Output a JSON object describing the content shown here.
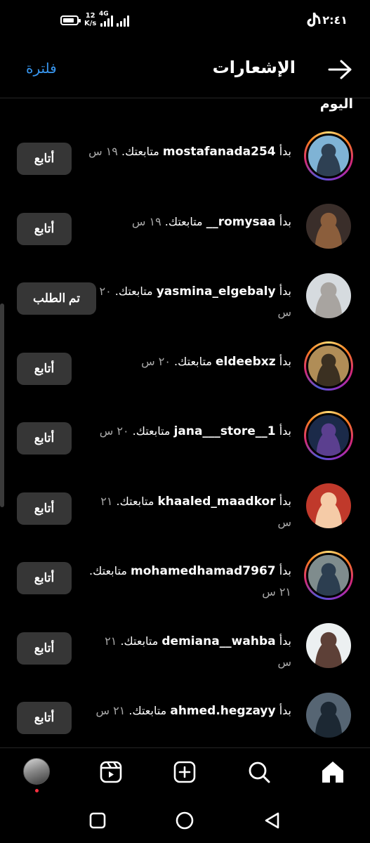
{
  "status_bar": {
    "time": "١٢:٤١",
    "net_speed_value": "12",
    "net_speed_unit": "K/s",
    "network_type": "4G",
    "battery_level": 0.85
  },
  "header": {
    "title": "الإشعارات",
    "filter_label": "فلترة"
  },
  "section": {
    "heading": "اليوم"
  },
  "notifications": [
    {
      "prefix": "بدأ",
      "username": "mostafanada254",
      "message": "متابعتك.",
      "time": "١٩ س",
      "button": "أتابع",
      "story_ring": true
    },
    {
      "prefix": "بدأ",
      "username": "romysaa__",
      "message": "متابعتك.",
      "time": "١٩ س",
      "button": "أتابع",
      "story_ring": false
    },
    {
      "prefix": "بدأ",
      "username": "yasmina_elgebaly",
      "message": "متابعتك.",
      "time": "٢٠ س",
      "button": "تم الطلب",
      "story_ring": false
    },
    {
      "prefix": "بدأ",
      "username": "eldeebxz",
      "message": "متابعتك.",
      "time": "٢٠ س",
      "button": "أتابع",
      "story_ring": true
    },
    {
      "prefix": "بدأ",
      "username": "jana___store__1",
      "message": "متابعتك.",
      "time": "٢٠ س",
      "button": "أتابع",
      "story_ring": true
    },
    {
      "prefix": "بدأ",
      "username": "khaaled_maadkor",
      "message": "متابعتك.",
      "time": "٢١ س",
      "button": "أتابع",
      "story_ring": false
    },
    {
      "prefix": "بدأ",
      "username": "mohamedhamad7967",
      "message": "متابعتك.",
      "time": "٢١ س",
      "button": "أتابع",
      "story_ring": true
    },
    {
      "prefix": "بدأ",
      "username": "demiana__wahba",
      "message": "متابعتك.",
      "time": "٢١ س",
      "button": "أتابع",
      "story_ring": false
    },
    {
      "prefix": "بدأ",
      "username": "ahmed.hegzayy",
      "message": "متابعتك.",
      "time": "٢١ س",
      "button": "أتابع",
      "story_ring": false
    }
  ],
  "bottom_nav": [
    {
      "icon": "profile-avatar-icon",
      "active": false
    },
    {
      "icon": "reels-icon",
      "active": false
    },
    {
      "icon": "create-post-icon",
      "active": false
    },
    {
      "icon": "search-icon",
      "active": false
    },
    {
      "icon": "home-icon",
      "active": true
    }
  ],
  "colors": {
    "background": "#000000",
    "accent_link": "#3897f0",
    "button_bg": "#363636",
    "secondary_text": "#a8a8a8",
    "notification_dot": "#ff3040"
  }
}
